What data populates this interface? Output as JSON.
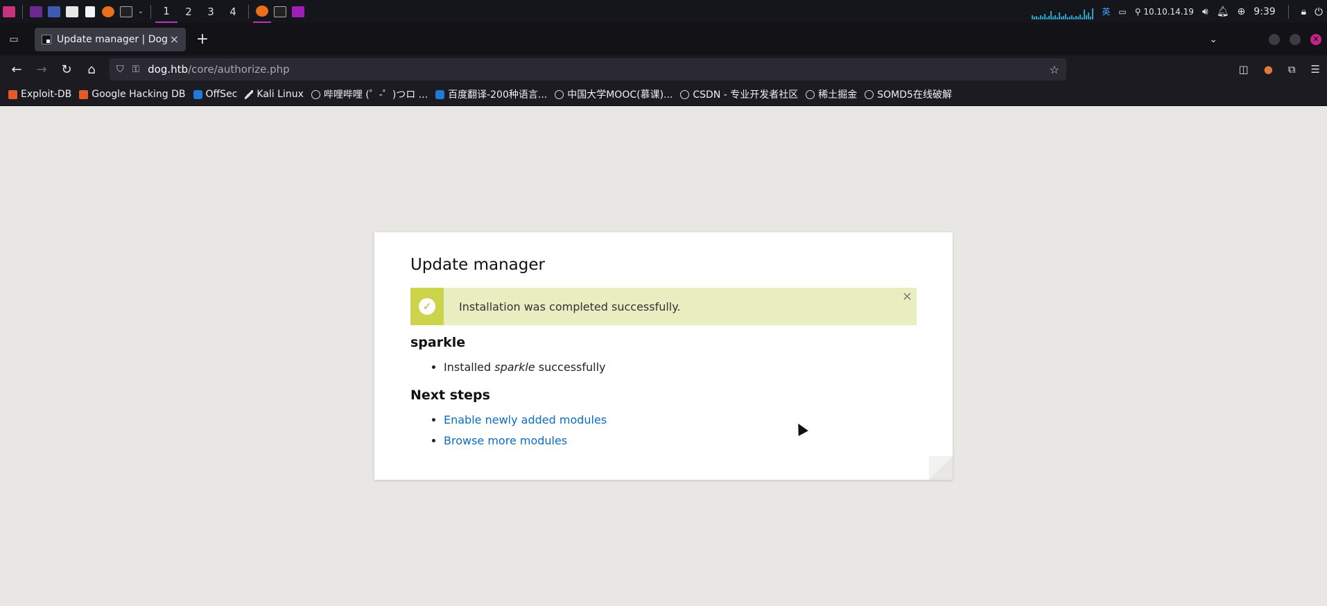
{
  "system_panel": {
    "workspaces": [
      "1",
      "2",
      "3",
      "4"
    ],
    "active_workspace": "1",
    "ime": "英",
    "ip": "10.10.14.19",
    "clock": "9:39"
  },
  "browser": {
    "tab": {
      "title": "Update manager | Dog",
      "close": "×"
    },
    "new_tab": "+",
    "url": {
      "host": "dog.htb",
      "path": "/core/authorize.php"
    },
    "bookmarks": [
      "Exploit-DB",
      "Google Hacking DB",
      "OffSec",
      "Kali Linux",
      "哔哩哔哩 (゜-゜)つロ ...",
      "百度翻译-200种语言...",
      "中国大学MOOC(慕课)...",
      "CSDN - 专业开发者社区",
      "稀土掘金",
      "SOMD5在线破解"
    ]
  },
  "page": {
    "title": "Update manager",
    "message": "Installation was completed successfully.",
    "message_close": "×",
    "section1": {
      "heading": "sparkle",
      "item_prefix": "Installed ",
      "item_name": "sparkle",
      "item_suffix": " successfully"
    },
    "section2": {
      "heading": "Next steps",
      "links": [
        "Enable newly added modules",
        "Browse more modules"
      ]
    }
  }
}
